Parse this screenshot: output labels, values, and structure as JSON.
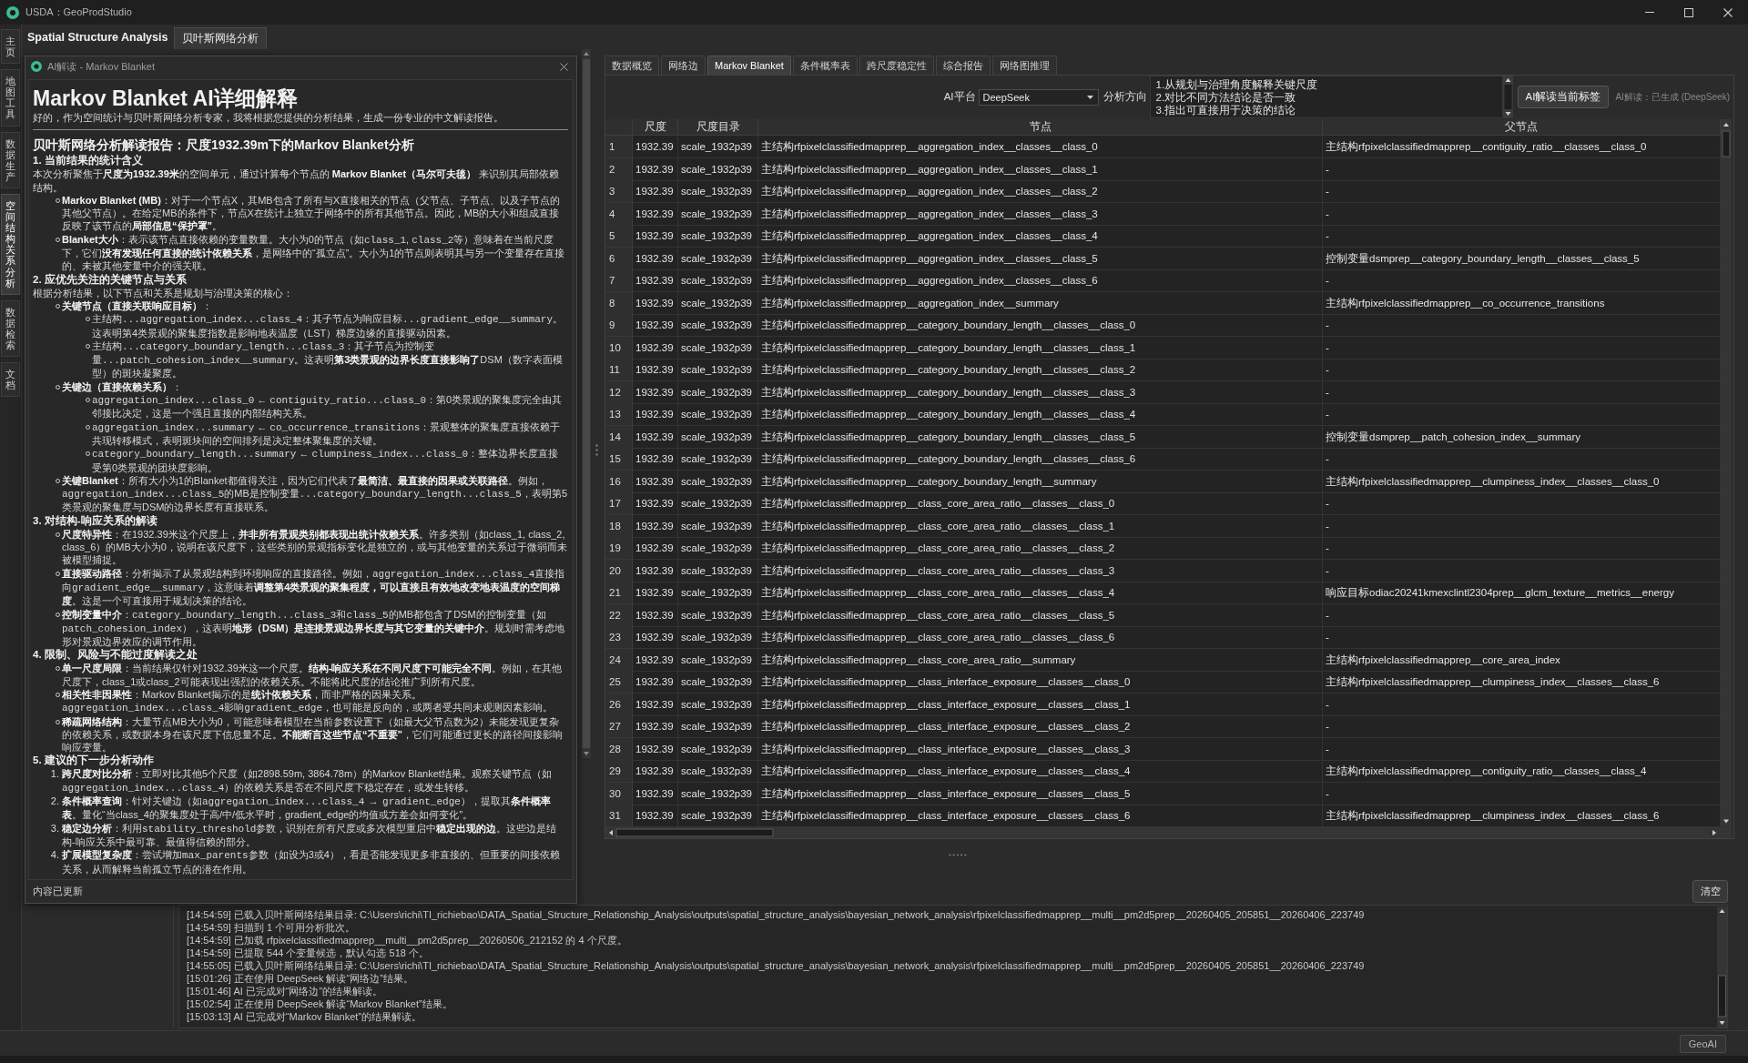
{
  "window": {
    "title": "USDA：GeoProdStudio"
  },
  "sidebar": {
    "items": [
      {
        "label": "主页",
        "selected": false
      },
      {
        "label": "地图工具",
        "selected": false
      },
      {
        "label": "数据生产",
        "selected": false
      },
      {
        "label": "空间结构关系分析",
        "selected": true
      },
      {
        "label": "数据检索",
        "selected": false
      },
      {
        "label": "文档",
        "selected": false
      }
    ]
  },
  "header": {
    "title": "Spatial Structure Analysis",
    "tabs": [
      {
        "label": "贝叶斯网络分析",
        "selected": true
      }
    ]
  },
  "panel": {
    "tabs": [
      {
        "label": "数据概览",
        "selected": false
      },
      {
        "label": "网络边",
        "selected": false
      },
      {
        "label": "Markov Blanket",
        "selected": true
      },
      {
        "label": "条件概率表",
        "selected": false
      },
      {
        "label": "跨尺度稳定性",
        "selected": false
      },
      {
        "label": "综合报告",
        "selected": false
      },
      {
        "label": "网络图推理",
        "selected": false
      }
    ],
    "toolbar": {
      "platform_label": "AI平台",
      "platform": "DeepSeek",
      "direction_label": "分析方向",
      "direction": [
        "1.从规划与治理角度解释关键尺度",
        "2.对比不同方法结论是否一致",
        "3.指出可直接用于决策的结论"
      ],
      "button": "AI解读当前标签",
      "status": "AI解读：已生成 (DeepSeek)"
    },
    "table": {
      "columns": [
        "",
        "尺度",
        "尺度目录",
        "节点",
        "父节点"
      ],
      "rows": [
        [
          "1",
          "1932.39",
          "scale_1932p39",
          "主结构rfpixelclassifiedmapprep__aggregation_index__classes__class_0",
          "主结构rfpixelclassifiedmapprep__contiguity_ratio__classes__class_0"
        ],
        [
          "2",
          "1932.39",
          "scale_1932p39",
          "主结构rfpixelclassifiedmapprep__aggregation_index__classes__class_1",
          "-"
        ],
        [
          "3",
          "1932.39",
          "scale_1932p39",
          "主结构rfpixelclassifiedmapprep__aggregation_index__classes__class_2",
          "-"
        ],
        [
          "4",
          "1932.39",
          "scale_1932p39",
          "主结构rfpixelclassifiedmapprep__aggregation_index__classes__class_3",
          "-"
        ],
        [
          "5",
          "1932.39",
          "scale_1932p39",
          "主结构rfpixelclassifiedmapprep__aggregation_index__classes__class_4",
          "-"
        ],
        [
          "6",
          "1932.39",
          "scale_1932p39",
          "主结构rfpixelclassifiedmapprep__aggregation_index__classes__class_5",
          "控制变量dsmprep__category_boundary_length__classes__class_5"
        ],
        [
          "7",
          "1932.39",
          "scale_1932p39",
          "主结构rfpixelclassifiedmapprep__aggregation_index__classes__class_6",
          "-"
        ],
        [
          "8",
          "1932.39",
          "scale_1932p39",
          "主结构rfpixelclassifiedmapprep__aggregation_index__summary",
          "主结构rfpixelclassifiedmapprep__co_occurrence_transitions"
        ],
        [
          "9",
          "1932.39",
          "scale_1932p39",
          "主结构rfpixelclassifiedmapprep__category_boundary_length__classes__class_0",
          "-"
        ],
        [
          "10",
          "1932.39",
          "scale_1932p39",
          "主结构rfpixelclassifiedmapprep__category_boundary_length__classes__class_1",
          "-"
        ],
        [
          "11",
          "1932.39",
          "scale_1932p39",
          "主结构rfpixelclassifiedmapprep__category_boundary_length__classes__class_2",
          "-"
        ],
        [
          "12",
          "1932.39",
          "scale_1932p39",
          "主结构rfpixelclassifiedmapprep__category_boundary_length__classes__class_3",
          "-"
        ],
        [
          "13",
          "1932.39",
          "scale_1932p39",
          "主结构rfpixelclassifiedmapprep__category_boundary_length__classes__class_4",
          "-"
        ],
        [
          "14",
          "1932.39",
          "scale_1932p39",
          "主结构rfpixelclassifiedmapprep__category_boundary_length__classes__class_5",
          "控制变量dsmprep__patch_cohesion_index__summary"
        ],
        [
          "15",
          "1932.39",
          "scale_1932p39",
          "主结构rfpixelclassifiedmapprep__category_boundary_length__classes__class_6",
          "-"
        ],
        [
          "16",
          "1932.39",
          "scale_1932p39",
          "主结构rfpixelclassifiedmapprep__category_boundary_length__summary",
          "主结构rfpixelclassifiedmapprep__clumpiness_index__classes__class_0"
        ],
        [
          "17",
          "1932.39",
          "scale_1932p39",
          "主结构rfpixelclassifiedmapprep__class_core_area_ratio__classes__class_0",
          "-"
        ],
        [
          "18",
          "1932.39",
          "scale_1932p39",
          "主结构rfpixelclassifiedmapprep__class_core_area_ratio__classes__class_1",
          "-"
        ],
        [
          "19",
          "1932.39",
          "scale_1932p39",
          "主结构rfpixelclassifiedmapprep__class_core_area_ratio__classes__class_2",
          "-"
        ],
        [
          "20",
          "1932.39",
          "scale_1932p39",
          "主结构rfpixelclassifiedmapprep__class_core_area_ratio__classes__class_3",
          "-"
        ],
        [
          "21",
          "1932.39",
          "scale_1932p39",
          "主结构rfpixelclassifiedmapprep__class_core_area_ratio__classes__class_4",
          "响应目标odiac20241kmexclintl2304prep__glcm_texture__metrics__energy"
        ],
        [
          "22",
          "1932.39",
          "scale_1932p39",
          "主结构rfpixelclassifiedmapprep__class_core_area_ratio__classes__class_5",
          "-"
        ],
        [
          "23",
          "1932.39",
          "scale_1932p39",
          "主结构rfpixelclassifiedmapprep__class_core_area_ratio__classes__class_6",
          "-"
        ],
        [
          "24",
          "1932.39",
          "scale_1932p39",
          "主结构rfpixelclassifiedmapprep__class_core_area_ratio__summary",
          "主结构rfpixelclassifiedmapprep__core_area_index"
        ],
        [
          "25",
          "1932.39",
          "scale_1932p39",
          "主结构rfpixelclassifiedmapprep__class_interface_exposure__classes__class_0",
          "主结构rfpixelclassifiedmapprep__clumpiness_index__classes__class_6"
        ],
        [
          "26",
          "1932.39",
          "scale_1932p39",
          "主结构rfpixelclassifiedmapprep__class_interface_exposure__classes__class_1",
          "-"
        ],
        [
          "27",
          "1932.39",
          "scale_1932p39",
          "主结构rfpixelclassifiedmapprep__class_interface_exposure__classes__class_2",
          "-"
        ],
        [
          "28",
          "1932.39",
          "scale_1932p39",
          "主结构rfpixelclassifiedmapprep__class_interface_exposure__classes__class_3",
          "-"
        ],
        [
          "29",
          "1932.39",
          "scale_1932p39",
          "主结构rfpixelclassifiedmapprep__class_interface_exposure__classes__class_4",
          "主结构rfpixelclassifiedmapprep__contiguity_ratio__classes__class_4"
        ],
        [
          "30",
          "1932.39",
          "scale_1932p39",
          "主结构rfpixelclassifiedmapprep__class_interface_exposure__classes__class_5",
          "-"
        ],
        [
          "31",
          "1932.39",
          "scale_1932p39",
          "主结构rfpixelclassifiedmapprep__class_interface_exposure__classes__class_6",
          "主结构rfpixelclassifiedmapprep__clumpiness_index__classes__class_6"
        ]
      ]
    }
  },
  "dialog": {
    "title": "AI解读 - Markov Blanket",
    "heading": "Markov Blanket AI详细解释",
    "intro": "好的，作为空间统计与贝叶斯网络分析专家，我将根据您提供的分析结果，生成一份专业的中文解读报告。",
    "report_title": "贝叶斯网络分析解读报告：尺度1932.39m下的Markov Blanket分析",
    "blocks": [
      {
        "kind": "h3",
        "text": "1. 当前结果的统计含义"
      },
      {
        "kind": "p",
        "runs": [
          {
            "kind": "text",
            "text": "本次分析聚焦于**尺度为1932.39米**的空间单元，通过计算每个节点的 **Markov Blanket（马尔可夫毯）** 来识别其局部依赖结构。"
          }
        ]
      },
      {
        "kind": "ul",
        "items": [
          {
            "runs": [
              {
                "kind": "text",
                "text": "**Markov Blanket (MB)**：对于一个节点X，其MB包含了所有与X直接相关的节点（父节点、子节点、以及子节点的其他父节点）。在给定MB的条件下，节点X在统计上独立于网络中的所有其他节点。因此，MB的大小和组成直接反映了该节点的**局部信息“保护罩”**。"
              }
            ]
          },
          {
            "runs": [
              {
                "kind": "text",
                "text": "**Blanket大小**：表示该节点直接依赖的变量数量。大小为0的节点（如"
              },
              {
                "kind": "code",
                "text": "class_1"
              },
              {
                "kind": "text",
                "text": ", "
              },
              {
                "kind": "code",
                "text": "class_2"
              },
              {
                "kind": "text",
                "text": "等）意味着在当前尺度下，它们**没有发现任何直接的统计依赖关系**，是网络中的“孤立点”。大小为1的节点则表明其与另一个变量存在直接的、未被其他变量中介的强关联。"
              }
            ]
          }
        ]
      },
      {
        "kind": "h3",
        "text": "2. 应优先关注的关键节点与关系"
      },
      {
        "kind": "p",
        "runs": [
          {
            "kind": "text",
            "text": "根据分析结果，以下节点和关系是规划与治理决策的核心："
          }
        ]
      },
      {
        "kind": "ul",
        "items": [
          {
            "runs": [
              {
                "kind": "text",
                "text": "**关键节点（直接关联响应目标）**："
              }
            ],
            "children": [
              {
                "runs": [
                  {
                    "kind": "text",
                    "text": "主结构"
                  },
                  {
                    "kind": "code",
                    "text": "...aggregation_index...class_4"
                  },
                  {
                    "kind": "text",
                    "text": "：其子节点为响应目标"
                  },
                  {
                    "kind": "code",
                    "text": "...gradient_edge__summary"
                  },
                  {
                    "kind": "text",
                    "text": "。这表明第4类景观的聚集度指数是影响地表温度（LST）梯度边缘的直接驱动因素。"
                  }
                ]
              },
              {
                "runs": [
                  {
                    "kind": "text",
                    "text": "主结构"
                  },
                  {
                    "kind": "code",
                    "text": "...category_boundary_length...class_3"
                  },
                  {
                    "kind": "text",
                    "text": "：其子节点为控制变量"
                  },
                  {
                    "kind": "code",
                    "text": "...patch_cohesion_index__summary"
                  },
                  {
                    "kind": "text",
                    "text": "。这表明**第3类景观的边界长度直接影响了**DSM（数字表面模型）的斑块凝聚度。"
                  }
                ]
              }
            ]
          },
          {
            "runs": [
              {
                "kind": "text",
                "text": "**关键边（直接依赖关系）**："
              }
            ],
            "children": [
              {
                "runs": [
                  {
                    "kind": "code",
                    "text": "aggregation_index...class_0"
                  },
                  {
                    "kind": "text",
                    "text": " ← "
                  },
                  {
                    "kind": "code",
                    "text": "contiguity_ratio...class_0"
                  },
                  {
                    "kind": "text",
                    "text": "：第0类景观的聚集度完全由其邻接比决定，这是一个强且直接的内部结构关系。"
                  }
                ]
              },
              {
                "runs": [
                  {
                    "kind": "code",
                    "text": "aggregation_index...summary"
                  },
                  {
                    "kind": "text",
                    "text": " ← "
                  },
                  {
                    "kind": "code",
                    "text": "co_occurrence_transitions"
                  },
                  {
                    "kind": "text",
                    "text": "：景观整体的聚集度直接依赖于共现转移模式，表明斑块间的空间排列是决定整体聚集度的关键。"
                  }
                ]
              },
              {
                "runs": [
                  {
                    "kind": "code",
                    "text": "category_boundary_length...summary"
                  },
                  {
                    "kind": "text",
                    "text": " ← "
                  },
                  {
                    "kind": "code",
                    "text": "clumpiness_index...class_0"
                  },
                  {
                    "kind": "text",
                    "text": "：整体边界长度直接受第0类景观的团块度影响。"
                  }
                ]
              }
            ]
          },
          {
            "runs": [
              {
                "kind": "text",
                "text": "**关键Blanket**：所有大小为1的Blanket都值得关注，因为它们代表了**最简洁、最直接的因果或关联路径**。例如，"
              },
              {
                "kind": "code",
                "text": "aggregation_index...class_5"
              },
              {
                "kind": "text",
                "text": "的MB是控制变量"
              },
              {
                "kind": "code",
                "text": "...category_boundary_length...class_5"
              },
              {
                "kind": "text",
                "text": "，表明第5类景观的聚集度与DSM的边界长度有直接联系。"
              }
            ]
          }
        ]
      },
      {
        "kind": "h3",
        "text": "3. 对结构-响应关系的解读"
      },
      {
        "kind": "ul",
        "items": [
          {
            "runs": [
              {
                "kind": "text",
                "text": "**尺度特异性**：在1932.39米这个尺度上，**并非所有景观类别都表现出统计依赖关系**。许多类别（如class_1, class_2, class_6）的MB大小为0，说明在该尺度下，这些类别的景观指标变化是独立的，或与其他变量的关系过于微弱而未被模型捕捉。"
              }
            ]
          },
          {
            "runs": [
              {
                "kind": "text",
                "text": "**直接驱动路径**：分析揭示了从景观结构到环境响应的直接路径。例如，"
              },
              {
                "kind": "code",
                "text": "aggregation_index...class_4"
              },
              {
                "kind": "text",
                "text": "直接指向"
              },
              {
                "kind": "code",
                "text": "gradient_edge__summary"
              },
              {
                "kind": "text",
                "text": "，这意味着**调整第4类景观的聚集程度，可以直接且有效地改变地表温度的空间梯度**。这是一个可直接用于规划决策的结论。"
              }
            ]
          },
          {
            "runs": [
              {
                "kind": "text",
                "text": "**控制变量中介**："
              },
              {
                "kind": "code",
                "text": "category_boundary_length...class_3"
              },
              {
                "kind": "text",
                "text": "和"
              },
              {
                "kind": "code",
                "text": "class_5"
              },
              {
                "kind": "text",
                "text": "的MB都包含了DSM的控制变量（如"
              },
              {
                "kind": "code",
                "text": "patch_cohesion_index"
              },
              {
                "kind": "text",
                "text": "），这表明**地形（DSM）是连接景观边界长度与其它变量的关键中介**。规划时需考虑地形对景观边界效应的调节作用。"
              }
            ]
          }
        ]
      },
      {
        "kind": "h3",
        "text": "4. 限制、风险与不能过度解读之处"
      },
      {
        "kind": "ul",
        "items": [
          {
            "runs": [
              {
                "kind": "text",
                "text": "**单一尺度局限**：当前结果仅针对1932.39米这一个尺度。**结构-响应关系在不同尺度下可能完全不同**。例如，在其他尺度下，class_1或class_2可能表现出强烈的依赖关系。不能将此尺度的结论推广到所有尺度。"
              }
            ]
          },
          {
            "runs": [
              {
                "kind": "text",
                "text": "**相关性非因果性**：Markov Blanket揭示的是**统计依赖关系**，而非严格的因果关系。"
              },
              {
                "kind": "code",
                "text": "aggregation_index...class_4"
              },
              {
                "kind": "text",
                "text": "影响"
              },
              {
                "kind": "code",
                "text": "gradient_edge"
              },
              {
                "kind": "text",
                "text": "，也可能是反向的，或两者受共同未观测因素影响。"
              }
            ]
          },
          {
            "runs": [
              {
                "kind": "text",
                "text": "**稀疏网络结构**：大量节点MB大小为0，可能意味着模型在当前参数设置下（如最大父节点数为2）未能发现更复杂的依赖关系，或数据本身在该尺度下信息量不足。**不能断言这些节点“不重要”**，它们可能通过更长的路径间接影响响应变量。"
              }
            ]
          }
        ]
      },
      {
        "kind": "h3",
        "text": "5. 建议的下一步分析动作"
      },
      {
        "kind": "ol",
        "items": [
          {
            "marker": "1.",
            "runs": [
              {
                "kind": "text",
                "text": "**跨尺度对比分析**：立即对比其他5个尺度（如2898.59m, 3864.78m）的Markov Blanket结果。观察关键节点（如"
              },
              {
                "kind": "code",
                "text": "aggregation_index...class_4"
              },
              {
                "kind": "text",
                "text": "）的依赖关系是否在不同尺度下稳定存在，或发生转移。"
              }
            ]
          },
          {
            "marker": "2.",
            "runs": [
              {
                "kind": "text",
                "text": "**条件概率查询**：针对关键边（如"
              },
              {
                "kind": "code",
                "text": "aggregation_index...class_4 → gradient_edge"
              },
              {
                "kind": "text",
                "text": "），提取其**条件概率表**。量化“当class_4的聚集度处于高/中/低水平时，gradient_edge的均值或方差会如何变化”。"
              }
            ]
          },
          {
            "marker": "3.",
            "runs": [
              {
                "kind": "text",
                "text": "**稳定边分析**：利用"
              },
              {
                "kind": "code",
                "text": "stability_threshold"
              },
              {
                "kind": "text",
                "text": "参数，识别在所有尺度或多次模型重启中**稳定出现的边**。这些边是结构-响应关系中最可靠、最值得信赖的部分。"
              }
            ]
          },
          {
            "marker": "4.",
            "runs": [
              {
                "kind": "text",
                "text": "**扩展模型复杂度**：尝试增加"
              },
              {
                "kind": "code",
                "text": "max_parents"
              },
              {
                "kind": "text",
                "text": "参数（如设为3或4），看是否能发现更多非直接的、但重要的间接依赖关系，从而解释当前孤立节点的潜在作用。"
              }
            ]
          }
        ]
      }
    ],
    "status": "内容已更新"
  },
  "log": {
    "clear_button": "清空",
    "lines": [
      "[14:54:59] 已载入贝叶斯网络结果目录: C:\\Users\\richi\\TI_richiebao\\DATA_Spatial_Structure_Relationship_Analysis\\outputs\\spatial_structure_analysis\\bayesian_network_analysis\\rfpixelclassifiedmapprep__multi__pm2d5prep__20260405_205851__20260406_223749",
      "[14:54:59] 扫描到 1 个可用分析批次。",
      "[14:54:59] 已加载 rfpixelclassifiedmapprep__multi__pm2d5prep__20260506_212152 的 4 个尺度。",
      "[14:54:59] 已提取 544 个变量候选，默认勾选 518 个。",
      "[14:55:05] 已载入贝叶斯网络结果目录: C:\\Users\\richi\\TI_richiebao\\DATA_Spatial_Structure_Relationship_Analysis\\outputs\\spatial_structure_analysis\\bayesian_network_analysis\\rfpixelclassifiedmapprep__multi__pm2d5prep__20260405_205851__20260406_223749",
      "[15:01:26] 正在使用 DeepSeek 解读“网络边”结果。",
      "[15:01:46] AI 已完成对“网络边”的结果解读。",
      "[15:02:54] 正在使用 DeepSeek 解读“Markov Blanket”结果。",
      "[15:03:13] AI 已完成对“Markov Blanket”的结果解读。"
    ]
  },
  "status_bar": {
    "button": "GeoAI"
  }
}
